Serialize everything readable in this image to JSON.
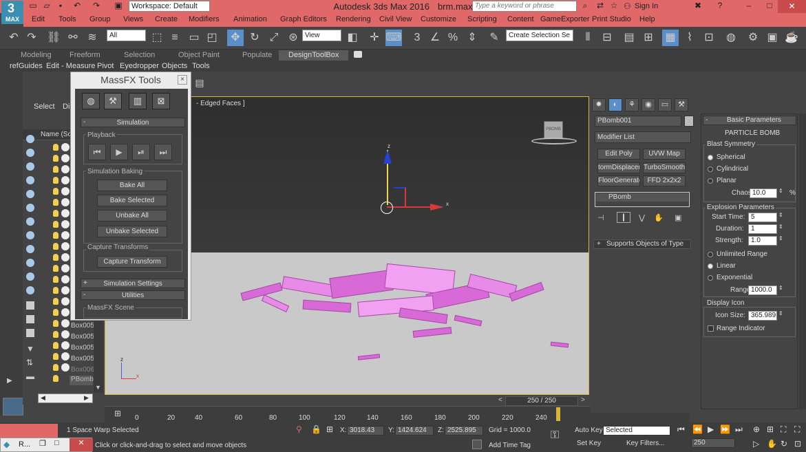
{
  "app": {
    "title_app": "Autodesk 3ds Max 2016",
    "title_file": "brm.max",
    "logo_text": "MAX",
    "workspace_label": "Workspace: Default",
    "search_placeholder": "Type a keyword or phrase",
    "sign_in": "Sign In",
    "accent_color": "#e06868"
  },
  "menu": [
    "Edit",
    "Tools",
    "Group",
    "Views",
    "Create",
    "Modifiers",
    "Animation",
    "Graph Editors",
    "Rendering",
    "Civil View",
    "Customize",
    "Scripting",
    "Content",
    "GameExporter",
    "Print Studio",
    "Help"
  ],
  "toolbar": {
    "selection_filter": "All",
    "ref_coord": "View",
    "snap_3": "3",
    "named_selection_placeholder": "Create Selection Se"
  },
  "ribbon_tabs": [
    "Modeling",
    "Freeform",
    "Selection",
    "Object Paint",
    "Populate",
    "DesignToolBox"
  ],
  "sub_toolbar": [
    "refGuides",
    "Edit - Measure",
    "Pivot",
    "Eyedropper",
    "Objects",
    "Tools"
  ],
  "scene_explorer": {
    "tab_select": "Select",
    "tab_display": "Di",
    "col_name": "Name (Sor",
    "rows": [
      "Box005",
      "Box005",
      "Box005",
      "Box005",
      "Box006",
      "PBomb"
    ]
  },
  "viewport": {
    "label": "- Edged Faces ]",
    "frame_counter": "250 / 250",
    "axis_z": "z",
    "axis_x": "x",
    "gizmo_label": "PBOMB"
  },
  "massfx": {
    "title": "MassFX Tools",
    "close": "×",
    "simulation_header": "Simulation",
    "playback_label": "Playback",
    "baking_label": "Simulation Baking",
    "bake_all": "Bake All",
    "bake_selected": "Bake Selected",
    "unbake_all": "Unbake All",
    "unbake_selected": "Unbake Selected",
    "capture_label": "Capture Transforms",
    "capture_transform": "Capture Transform",
    "sim_settings": "Simulation Settings",
    "utilities": "Utilities",
    "scene_label": "MassFX Scene"
  },
  "command_panel": {
    "object_name": "PBomb001",
    "modifier_list": "Modifier List",
    "buttons": [
      "Edit Poly",
      "UVW Map",
      "tormDisplaceme",
      "TurboSmooth",
      "FloorGenerator",
      "FFD 2x2x2"
    ],
    "stack_item": "PBomb",
    "supports_label": "Supports Objects of Type"
  },
  "basic_params": {
    "header": "Basic Parameters",
    "sub_header": "PARTICLE BOMB",
    "blast_symmetry": "Blast Symmetry",
    "spherical": "Spherical",
    "cylindrical": "Cylindrical",
    "planar": "Planar",
    "chaos_label": "Chaos:",
    "chaos_value": "10.0",
    "chaos_unit": "%",
    "explosion_params": "Explosion Parameters",
    "start_time_label": "Start Time:",
    "start_time": "5",
    "duration_label": "Duration:",
    "duration": "1",
    "strength_label": "Strength:",
    "strength": "1.0",
    "unlimited_range": "Unlimited Range",
    "linear": "Linear",
    "exponential": "Exponential",
    "range_label": "Range:",
    "range": "1000.0",
    "display_icon": "Display Icon",
    "icon_size_label": "Icon Size:",
    "icon_size": "365.989",
    "range_indicator": "Range Indicator"
  },
  "timeline_ticks": [
    "0",
    "20",
    "40",
    "60",
    "80",
    "100",
    "120",
    "140",
    "160",
    "180",
    "200",
    "220",
    "240"
  ],
  "status": {
    "selection_msg": "1 Space Warp Selected",
    "prompt": "Click or click-and-drag to select and move objects",
    "x_label": "X:",
    "x_value": "3018.43",
    "y_label": "Y:",
    "y_value": "1424.624",
    "z_label": "Z:",
    "z_value": "2525.895",
    "grid": "Grid = 1000.0",
    "add_time_tag": "Add Time Tag",
    "auto_key": "Auto Key",
    "set_key": "Set Key",
    "key_mode": "Selected",
    "key_filters": "Key Filters...",
    "frame": "250",
    "taskbar_item": "R..."
  }
}
